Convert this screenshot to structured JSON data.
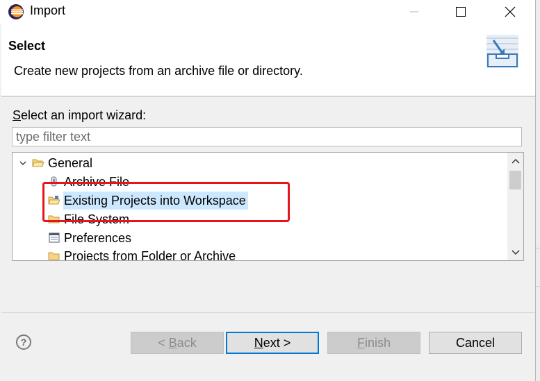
{
  "window": {
    "title": "Import"
  },
  "header": {
    "title": "Select",
    "description": "Create new projects from an archive file or directory."
  },
  "wizard": {
    "label_mnemonic": "S",
    "label_rest": "elect an import wizard:",
    "filter_placeholder": "type filter text",
    "tree": {
      "category": "General",
      "items": [
        {
          "label": "Archive File",
          "icon": "archive-file-icon"
        },
        {
          "label": "Existing Projects into Workspace",
          "icon": "folder-open-icon",
          "selected": true
        },
        {
          "label": "File System",
          "icon": "folder-icon"
        },
        {
          "label": "Preferences",
          "icon": "preferences-icon"
        },
        {
          "label": "Projects from Folder or Archive",
          "icon": "folder-icon"
        }
      ]
    }
  },
  "buttons": {
    "back_prefix": "< ",
    "back_mnemonic": "B",
    "back_rest": "ack",
    "next_mnemonic": "N",
    "next_rest": "ext >",
    "finish_mnemonic": "F",
    "finish_rest": "inish",
    "cancel": "Cancel"
  },
  "colors": {
    "highlight": "#e8141c",
    "selection": "#cce8ff",
    "default_button_border": "#0078d7"
  }
}
